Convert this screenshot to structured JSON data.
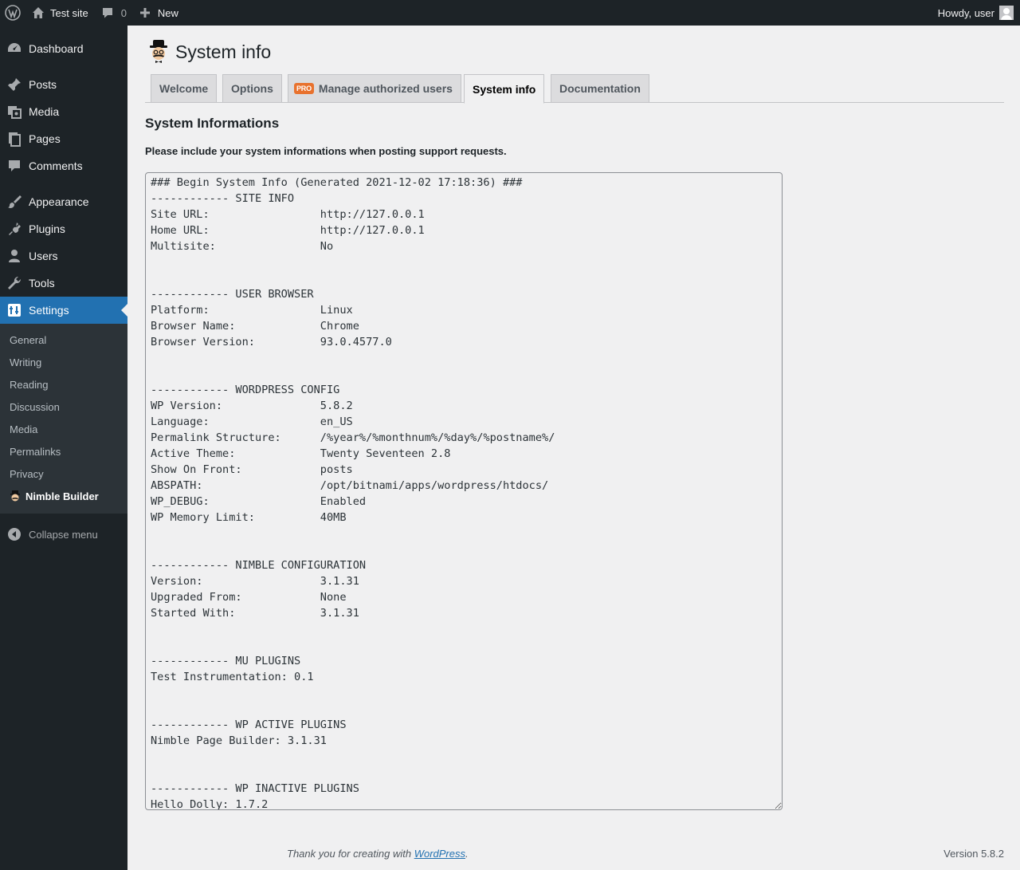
{
  "adminbar": {
    "site_name": "Test site",
    "comments_count": "0",
    "new_label": "New",
    "howdy": "Howdy, user"
  },
  "sidebar": {
    "menu": [
      {
        "label": "Dashboard",
        "icon": "dashboard-icon"
      },
      {
        "label": "Posts",
        "icon": "pin-icon"
      },
      {
        "label": "Media",
        "icon": "media-icon"
      },
      {
        "label": "Pages",
        "icon": "pages-icon"
      },
      {
        "label": "Comments",
        "icon": "comment-icon"
      },
      {
        "label": "Appearance",
        "icon": "brush-icon"
      },
      {
        "label": "Plugins",
        "icon": "plug-icon"
      },
      {
        "label": "Users",
        "icon": "user-icon"
      },
      {
        "label": "Tools",
        "icon": "wrench-icon"
      },
      {
        "label": "Settings",
        "icon": "settings-icon"
      }
    ],
    "submenu": [
      "General",
      "Writing",
      "Reading",
      "Discussion",
      "Media",
      "Permalinks",
      "Privacy",
      "Nimble Builder"
    ],
    "collapse_label": "Collapse menu"
  },
  "page": {
    "title": "System info",
    "tabs": [
      "Welcome",
      "Options",
      "Manage authorized users",
      "System info",
      "Documentation"
    ],
    "pro_badge": "PRO",
    "section_title": "System Informations",
    "intro": "Please include your system informations when posting support requests.",
    "sysinfo": "### Begin System Info (Generated 2021-12-02 17:18:36) ###\n------------ SITE INFO\nSite URL:                 http://127.0.0.1\nHome URL:                 http://127.0.0.1\nMultisite:                No\n\n\n------------ USER BROWSER\nPlatform:                 Linux\nBrowser Name:             Chrome\nBrowser Version:          93.0.4577.0\n\n\n------------ WORDPRESS CONFIG\nWP Version:               5.8.2\nLanguage:                 en_US\nPermalink Structure:      /%year%/%monthnum%/%day%/%postname%/\nActive Theme:             Twenty Seventeen 2.8\nShow On Front:            posts\nABSPATH:                  /opt/bitnami/apps/wordpress/htdocs/\nWP_DEBUG:                 Enabled\nWP Memory Limit:          40MB\n\n\n------------ NIMBLE CONFIGURATION\nVersion:                  3.1.31\nUpgraded From:            None\nStarted With:             3.1.31\n\n\n------------ MU PLUGINS\nTest Instrumentation: 0.1\n\n\n------------ WP ACTIVE PLUGINS\nNimble Page Builder: 3.1.31\n\n\n------------ WP INACTIVE PLUGINS\nHello Dolly: 1.7.2"
  },
  "footer": {
    "thanks_prefix": "Thank you for creating with ",
    "thanks_link": "WordPress",
    "thanks_suffix": ".",
    "version": "Version 5.8.2"
  },
  "colors": {
    "adminbar_bg": "#1d2327",
    "accent": "#2271b1",
    "pro_badge": "#e8722e"
  }
}
